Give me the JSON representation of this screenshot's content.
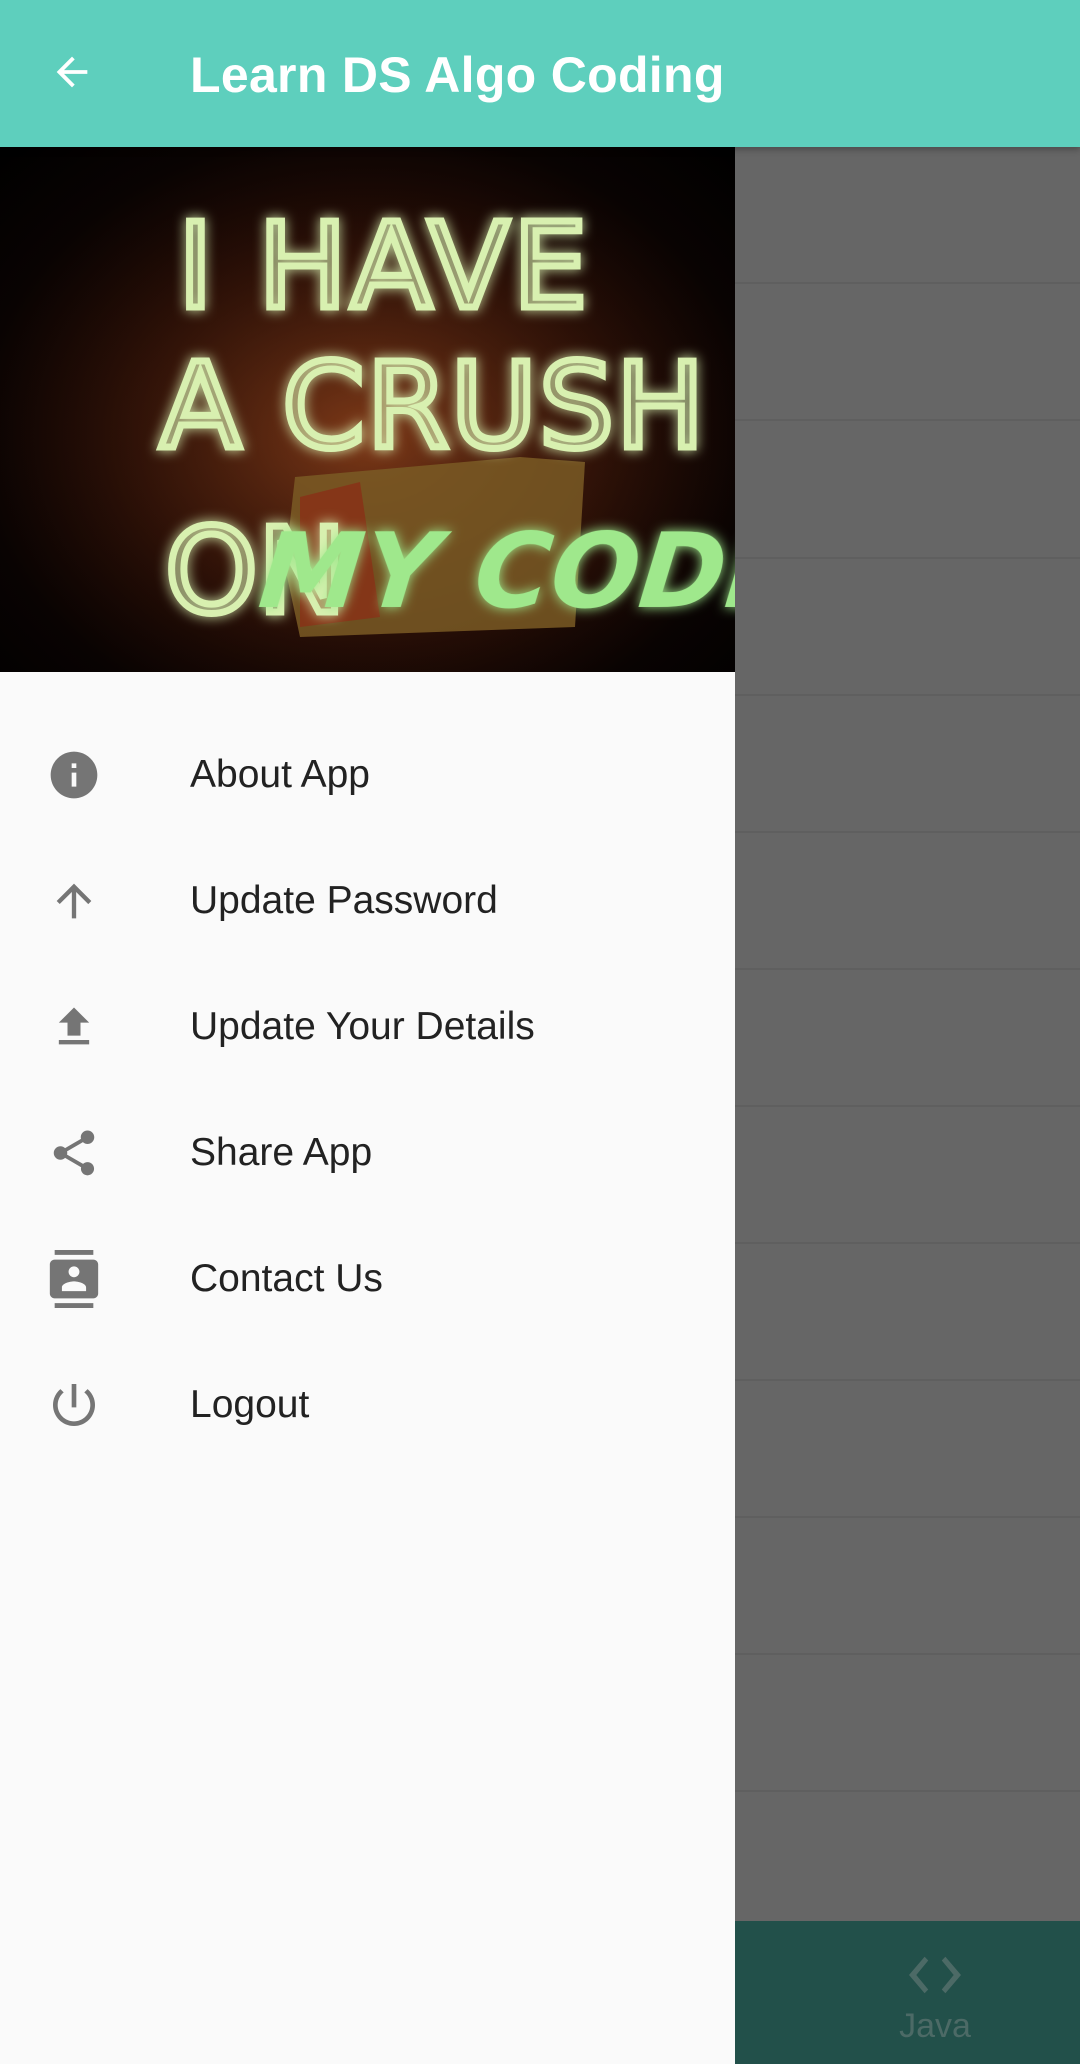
{
  "app_bar": {
    "title": "Learn DS Algo Coding",
    "back_icon": "arrow-back-icon",
    "background_color": "#5ecfbd"
  },
  "drawer": {
    "header_image": {
      "line1": "I HAVE",
      "line2": "A CRUSH",
      "line3_plain": "ON",
      "line3_bold": "MY CODE"
    },
    "menu_items": [
      {
        "label": "About App",
        "icon": "info-icon"
      },
      {
        "label": "Update Password",
        "icon": "arrow-up-icon"
      },
      {
        "label": "Update Your Details",
        "icon": "upload-icon"
      },
      {
        "label": "Share App",
        "icon": "share-icon"
      },
      {
        "label": "Contact Us",
        "icon": "contacts-icon"
      },
      {
        "label": "Logout",
        "icon": "power-icon"
      }
    ]
  },
  "bottom_nav": {
    "java_label": "Java",
    "java_icon": "code-icon"
  }
}
